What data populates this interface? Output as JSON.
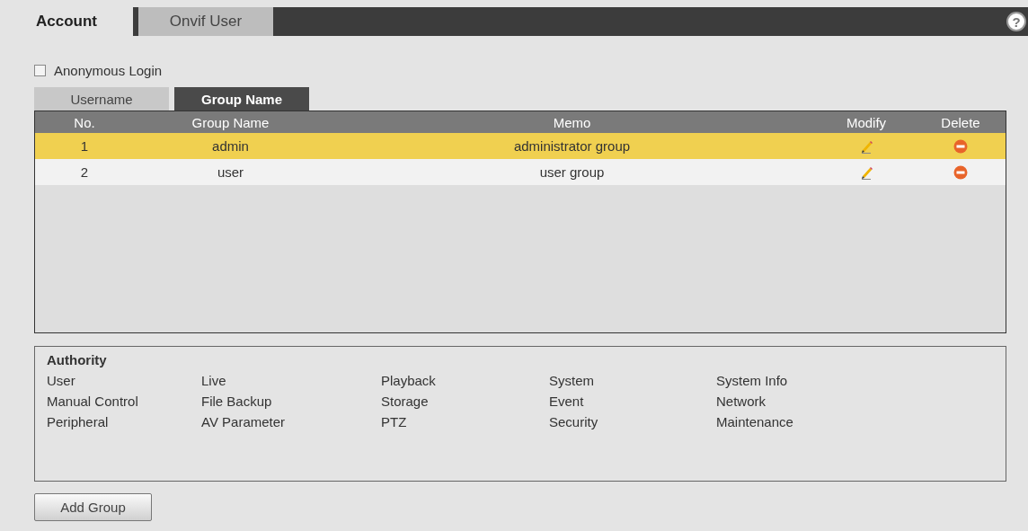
{
  "tabs": [
    {
      "label": "Account",
      "selected": true
    },
    {
      "label": "Onvif User",
      "selected": false
    }
  ],
  "help": "?",
  "anonymous_login": {
    "label": "Anonymous Login",
    "checked": false
  },
  "subtabs": [
    {
      "label": "Username",
      "selected": false
    },
    {
      "label": "Group Name",
      "selected": true
    }
  ],
  "table": {
    "columns": [
      "No.",
      "Group Name",
      "Memo",
      "Modify",
      "Delete"
    ],
    "rows": [
      {
        "no": "1",
        "group_name": "admin",
        "memo": "administrator group",
        "selected": true
      },
      {
        "no": "2",
        "group_name": "user",
        "memo": "user group",
        "selected": false
      }
    ]
  },
  "authority": {
    "title": "Authority",
    "items": [
      "User",
      "Live",
      "Playback",
      "System",
      "System Info",
      "Manual Control",
      "File Backup",
      "Storage",
      "Event",
      "Network",
      "Peripheral",
      "AV Parameter",
      "PTZ",
      "Security",
      "Maintenance"
    ]
  },
  "buttons": [
    "Add Group"
  ]
}
